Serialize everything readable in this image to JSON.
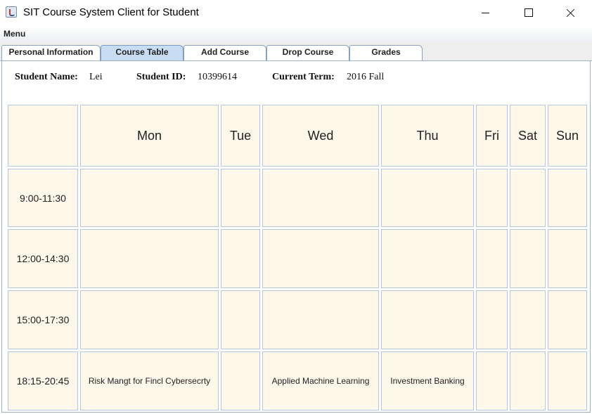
{
  "window": {
    "title": "SIT Course System Client for Student",
    "icon": "java-coffee-cup-icon"
  },
  "menubar": {
    "menu_label": "Menu"
  },
  "tabs": [
    {
      "label": "Personal Information",
      "selected": false
    },
    {
      "label": "Course Table",
      "selected": true
    },
    {
      "label": "Add Course",
      "selected": false
    },
    {
      "label": "Drop Course",
      "selected": false
    },
    {
      "label": "Grades",
      "selected": false
    }
  ],
  "student": {
    "name_label": "Student Name:",
    "name": "Lei",
    "id_label": "Student ID:",
    "id": "10399614",
    "term_label": "Current Term:",
    "term": "2016 Fall"
  },
  "table": {
    "corner": "",
    "days": [
      "Mon",
      "Tue",
      "Wed",
      "Thu",
      "Fri",
      "Sat",
      "Sun"
    ],
    "times": [
      "9:00-11:30",
      "12:00-14:30",
      "15:00-17:30",
      "18:15-20:45"
    ],
    "cells": [
      [
        "",
        "",
        "",
        "",
        "",
        "",
        ""
      ],
      [
        "",
        "",
        "",
        "",
        "",
        "",
        ""
      ],
      [
        "",
        "",
        "",
        "",
        "",
        "",
        ""
      ],
      [
        "Risk Mangt for Fincl Cybersecrty",
        "",
        "Applied Machine Learning",
        "Investment Banking",
        "",
        "",
        ""
      ]
    ]
  },
  "colors": {
    "cell_background": "#fdf8ea",
    "cell_border": "#b3c8df",
    "selected_tab": "#c8dcf2"
  }
}
